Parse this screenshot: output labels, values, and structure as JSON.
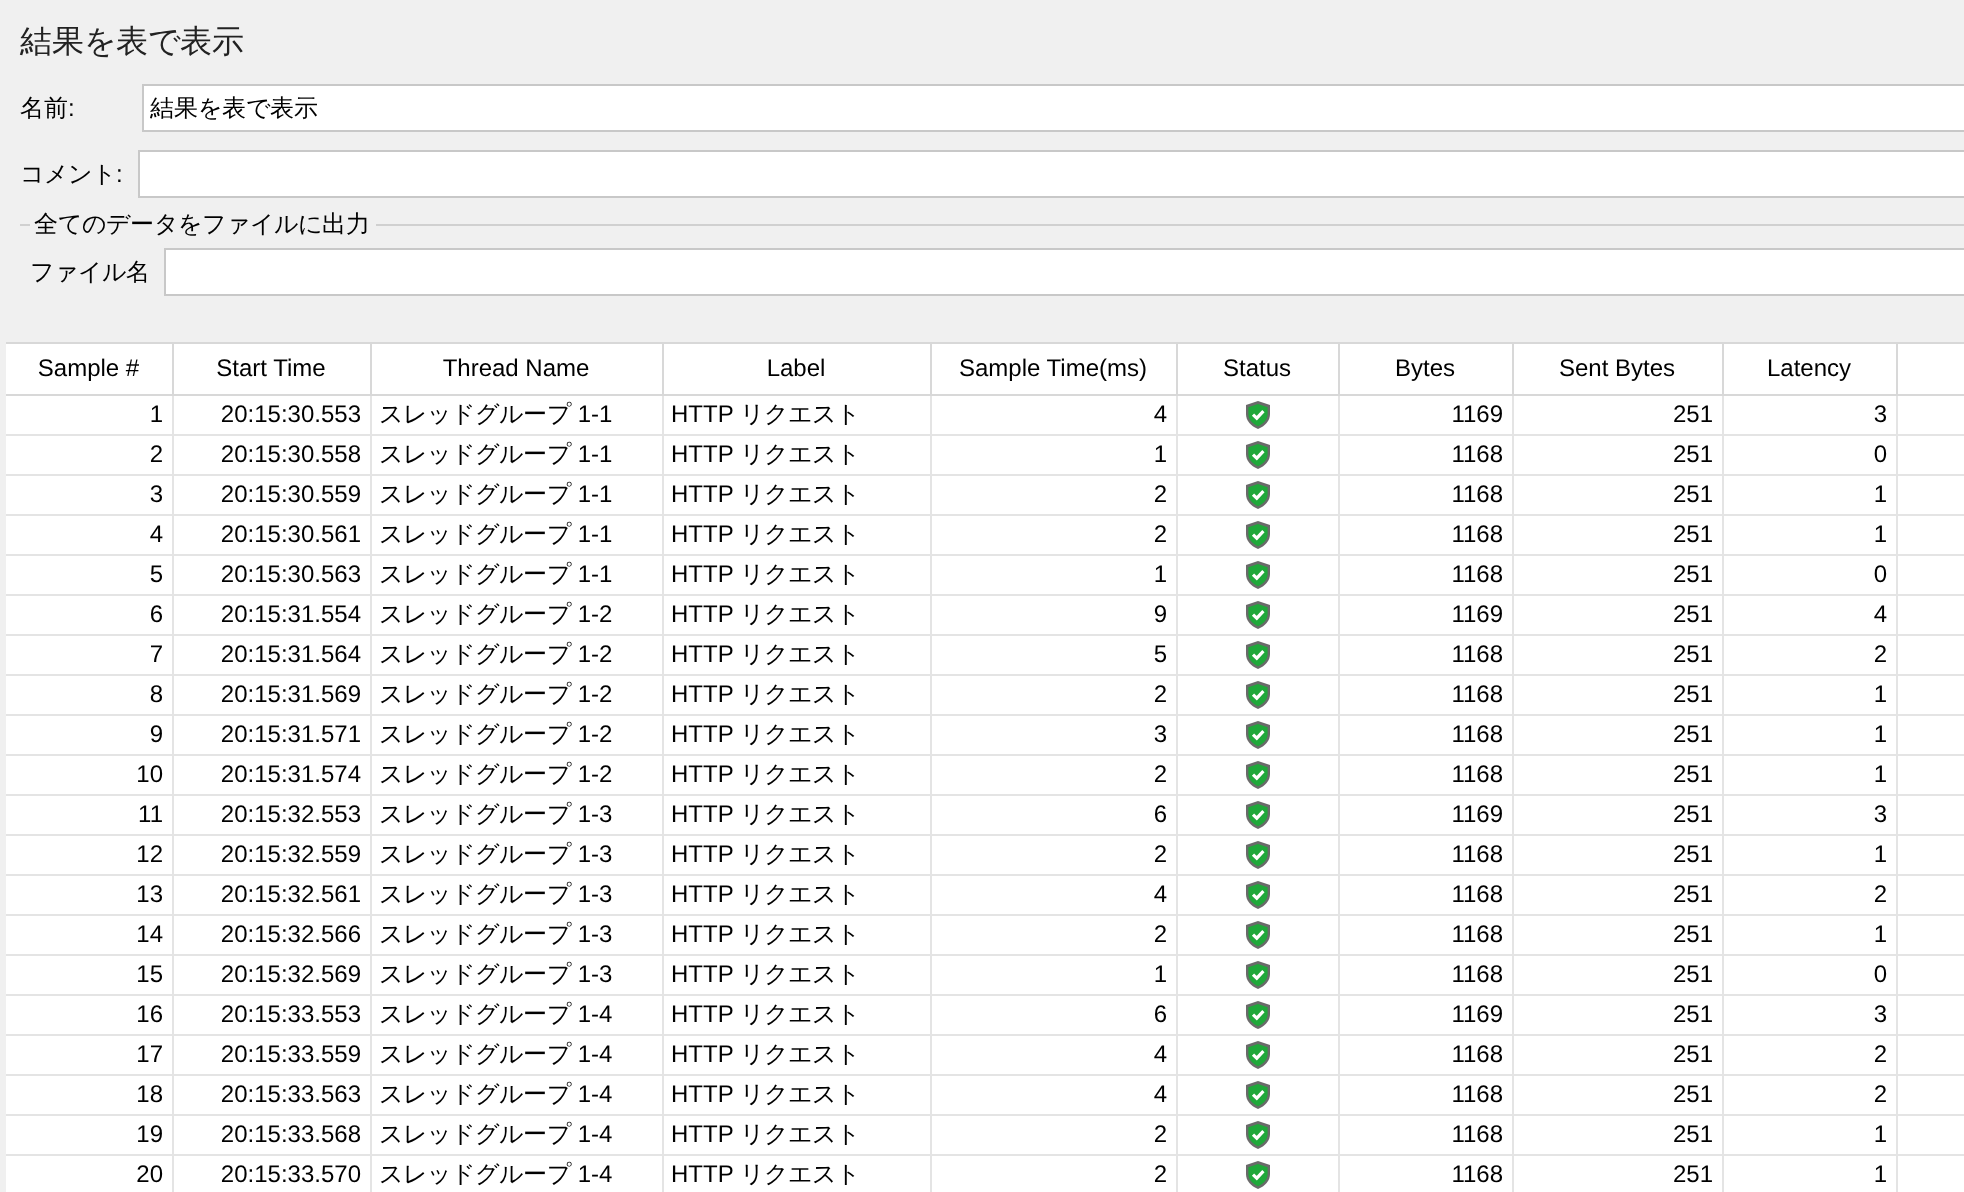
{
  "title": "結果を表で表示",
  "name_field": {
    "label": "名前:",
    "value": "結果を表で表示"
  },
  "comment_field": {
    "label": "コメント:"
  },
  "output_group": {
    "title": "全てのデータをファイルに出力",
    "file_label": "ファイル名"
  },
  "table": {
    "columns": [
      "Sample #",
      "Start Time",
      "Thread Name",
      "Label",
      "Sample Time(ms)",
      "Status",
      "Bytes",
      "Sent Bytes",
      "Latency"
    ],
    "rows": [
      {
        "sample": "1",
        "start": "20:15:30.553",
        "thread": "スレッドグループ 1-1",
        "label": "HTTP リクエスト",
        "time": "4",
        "ok": true,
        "bytes": "1169",
        "sent": "251",
        "latency": "3"
      },
      {
        "sample": "2",
        "start": "20:15:30.558",
        "thread": "スレッドグループ 1-1",
        "label": "HTTP リクエスト",
        "time": "1",
        "ok": true,
        "bytes": "1168",
        "sent": "251",
        "latency": "0"
      },
      {
        "sample": "3",
        "start": "20:15:30.559",
        "thread": "スレッドグループ 1-1",
        "label": "HTTP リクエスト",
        "time": "2",
        "ok": true,
        "bytes": "1168",
        "sent": "251",
        "latency": "1"
      },
      {
        "sample": "4",
        "start": "20:15:30.561",
        "thread": "スレッドグループ 1-1",
        "label": "HTTP リクエスト",
        "time": "2",
        "ok": true,
        "bytes": "1168",
        "sent": "251",
        "latency": "1"
      },
      {
        "sample": "5",
        "start": "20:15:30.563",
        "thread": "スレッドグループ 1-1",
        "label": "HTTP リクエスト",
        "time": "1",
        "ok": true,
        "bytes": "1168",
        "sent": "251",
        "latency": "0"
      },
      {
        "sample": "6",
        "start": "20:15:31.554",
        "thread": "スレッドグループ 1-2",
        "label": "HTTP リクエスト",
        "time": "9",
        "ok": true,
        "bytes": "1169",
        "sent": "251",
        "latency": "4"
      },
      {
        "sample": "7",
        "start": "20:15:31.564",
        "thread": "スレッドグループ 1-2",
        "label": "HTTP リクエスト",
        "time": "5",
        "ok": true,
        "bytes": "1168",
        "sent": "251",
        "latency": "2"
      },
      {
        "sample": "8",
        "start": "20:15:31.569",
        "thread": "スレッドグループ 1-2",
        "label": "HTTP リクエスト",
        "time": "2",
        "ok": true,
        "bytes": "1168",
        "sent": "251",
        "latency": "1"
      },
      {
        "sample": "9",
        "start": "20:15:31.571",
        "thread": "スレッドグループ 1-2",
        "label": "HTTP リクエスト",
        "time": "3",
        "ok": true,
        "bytes": "1168",
        "sent": "251",
        "latency": "1"
      },
      {
        "sample": "10",
        "start": "20:15:31.574",
        "thread": "スレッドグループ 1-2",
        "label": "HTTP リクエスト",
        "time": "2",
        "ok": true,
        "bytes": "1168",
        "sent": "251",
        "latency": "1"
      },
      {
        "sample": "11",
        "start": "20:15:32.553",
        "thread": "スレッドグループ 1-3",
        "label": "HTTP リクエスト",
        "time": "6",
        "ok": true,
        "bytes": "1169",
        "sent": "251",
        "latency": "3"
      },
      {
        "sample": "12",
        "start": "20:15:32.559",
        "thread": "スレッドグループ 1-3",
        "label": "HTTP リクエスト",
        "time": "2",
        "ok": true,
        "bytes": "1168",
        "sent": "251",
        "latency": "1"
      },
      {
        "sample": "13",
        "start": "20:15:32.561",
        "thread": "スレッドグループ 1-3",
        "label": "HTTP リクエスト",
        "time": "4",
        "ok": true,
        "bytes": "1168",
        "sent": "251",
        "latency": "2"
      },
      {
        "sample": "14",
        "start": "20:15:32.566",
        "thread": "スレッドグループ 1-3",
        "label": "HTTP リクエスト",
        "time": "2",
        "ok": true,
        "bytes": "1168",
        "sent": "251",
        "latency": "1"
      },
      {
        "sample": "15",
        "start": "20:15:32.569",
        "thread": "スレッドグループ 1-3",
        "label": "HTTP リクエスト",
        "time": "1",
        "ok": true,
        "bytes": "1168",
        "sent": "251",
        "latency": "0"
      },
      {
        "sample": "16",
        "start": "20:15:33.553",
        "thread": "スレッドグループ 1-4",
        "label": "HTTP リクエスト",
        "time": "6",
        "ok": true,
        "bytes": "1169",
        "sent": "251",
        "latency": "3"
      },
      {
        "sample": "17",
        "start": "20:15:33.559",
        "thread": "スレッドグループ 1-4",
        "label": "HTTP リクエスト",
        "time": "4",
        "ok": true,
        "bytes": "1168",
        "sent": "251",
        "latency": "2"
      },
      {
        "sample": "18",
        "start": "20:15:33.563",
        "thread": "スレッドグループ 1-4",
        "label": "HTTP リクエスト",
        "time": "4",
        "ok": true,
        "bytes": "1168",
        "sent": "251",
        "latency": "2"
      },
      {
        "sample": "19",
        "start": "20:15:33.568",
        "thread": "スレッドグループ 1-4",
        "label": "HTTP リクエスト",
        "time": "2",
        "ok": true,
        "bytes": "1168",
        "sent": "251",
        "latency": "1"
      },
      {
        "sample": "20",
        "start": "20:15:33.570",
        "thread": "スレッドグループ 1-4",
        "label": "HTTP リクエスト",
        "time": "2",
        "ok": true,
        "bytes": "1168",
        "sent": "251",
        "latency": "1"
      }
    ]
  }
}
